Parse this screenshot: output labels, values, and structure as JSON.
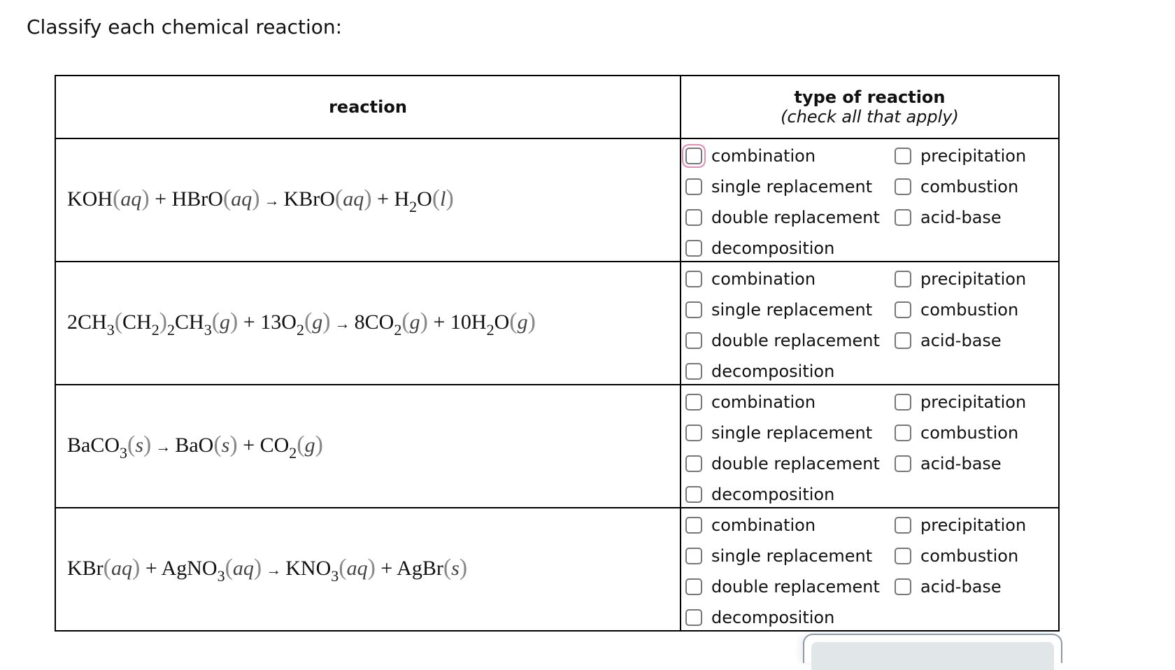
{
  "prompt": "Classify each chemical reaction:",
  "table": {
    "header_reaction": "reaction",
    "header_type": "type of reaction",
    "header_type_sub": "(check all that apply)"
  },
  "options_left": [
    "combination",
    "single replacement",
    "double replacement",
    "decomposition"
  ],
  "options_right": [
    "precipitation",
    "combustion",
    "acid-base"
  ],
  "accent_focus_color": "#e68ab8",
  "reactions": [
    {
      "equation": "KOH(aq) + HBrO(aq) → KBrO(aq) + H2O(l)",
      "checked": {
        "combination": false,
        "single replacement": false,
        "double replacement": false,
        "decomposition": false,
        "precipitation": false,
        "combustion": false,
        "acid-base": false
      }
    },
    {
      "equation": "2CH3(CH2)2CH3(g) + 13O2(g) → 8CO2(g) + 10H2O(g)",
      "checked": {
        "combination": false,
        "single replacement": false,
        "double replacement": false,
        "decomposition": false,
        "precipitation": false,
        "combustion": false,
        "acid-base": false
      }
    },
    {
      "equation": "BaCO3(s) → BaO(s) + CO2(g)",
      "checked": {
        "combination": false,
        "single replacement": false,
        "double replacement": false,
        "decomposition": false,
        "precipitation": false,
        "combustion": false,
        "acid-base": false
      }
    },
    {
      "equation": "KBr(aq) + AgNO3(aq) → KNO3(aq) + AgBr(s)",
      "checked": {
        "combination": false,
        "single replacement": false,
        "double replacement": false,
        "decomposition": false,
        "precipitation": false,
        "combustion": false,
        "acid-base": false
      }
    }
  ],
  "eq_parts": [
    [
      [
        "t",
        "KOH"
      ],
      [
        "p",
        "aq"
      ],
      [
        "t",
        " + HBrO"
      ],
      [
        "p",
        "aq"
      ],
      [
        "a",
        ""
      ],
      [
        "t",
        "KBrO"
      ],
      [
        "p",
        "aq"
      ],
      [
        "t",
        " + H"
      ],
      [
        "s",
        "2"
      ],
      [
        "t",
        "O"
      ],
      [
        "p",
        "l"
      ]
    ],
    [
      [
        "t",
        "2CH"
      ],
      [
        "s",
        "3"
      ],
      [
        "bp",
        "("
      ],
      [
        "t",
        "CH"
      ],
      [
        "s",
        "2"
      ],
      [
        "bp",
        ")"
      ],
      [
        "s",
        "2"
      ],
      [
        "t",
        "CH"
      ],
      [
        "s",
        "3"
      ],
      [
        "p",
        "g"
      ],
      [
        "t",
        " + 13O"
      ],
      [
        "s",
        "2"
      ],
      [
        "p",
        "g"
      ],
      [
        "a",
        ""
      ],
      [
        "t",
        "8CO"
      ],
      [
        "s",
        "2"
      ],
      [
        "p",
        "g"
      ],
      [
        "t",
        " + 10H"
      ],
      [
        "s",
        "2"
      ],
      [
        "t",
        "O"
      ],
      [
        "p",
        "g"
      ]
    ],
    [
      [
        "t",
        "BaCO"
      ],
      [
        "s",
        "3"
      ],
      [
        "p",
        "s"
      ],
      [
        "a",
        ""
      ],
      [
        "t",
        "BaO"
      ],
      [
        "p",
        "s"
      ],
      [
        "t",
        " + CO"
      ],
      [
        "s",
        "2"
      ],
      [
        "p",
        "g"
      ]
    ],
    [
      [
        "t",
        "KBr"
      ],
      [
        "p",
        "aq"
      ],
      [
        "t",
        " + AgNO"
      ],
      [
        "s",
        "3"
      ],
      [
        "p",
        "aq"
      ],
      [
        "a",
        ""
      ],
      [
        "t",
        "KNO"
      ],
      [
        "s",
        "3"
      ],
      [
        "p",
        "aq"
      ],
      [
        "t",
        " + AgBr"
      ],
      [
        "p",
        "s"
      ]
    ]
  ]
}
